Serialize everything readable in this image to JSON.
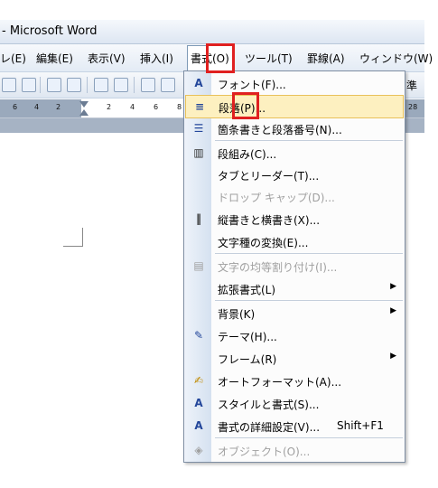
{
  "window": {
    "title": "- Microsoft Word"
  },
  "menubar": {
    "items": [
      "レ(E)",
      "編集(E)",
      "表示(V)",
      "挿入(I)",
      "書式(O)",
      "ツール(T)",
      "罫線(A)",
      "ウィンドウ(W)"
    ]
  },
  "toolbar": {
    "trailing_text": "準"
  },
  "ruler": {
    "ticks": [
      "6",
      "4",
      "2",
      "2",
      "4",
      "6",
      "8",
      "28"
    ]
  },
  "format_menu": {
    "items": [
      {
        "label": "フォント(F)...",
        "icon": "font-icon"
      },
      {
        "label": "段落(P)...",
        "icon": "paragraph-icon",
        "highlighted": true
      },
      {
        "label": "箇条書きと段落番号(N)...",
        "icon": "bullets-icon"
      },
      {
        "label": "段組み(C)...",
        "icon": "columns-icon"
      },
      {
        "label": "タブとリーダー(T)..."
      },
      {
        "label": "ドロップ キャップ(D)...",
        "disabled": true
      },
      {
        "label": "縦書きと横書き(X)...",
        "icon": "text-direction-icon"
      },
      {
        "label": "文字種の変換(E)..."
      },
      {
        "label": "文字の均等割り付け(I)...",
        "icon": "distribute-icon",
        "disabled": true
      },
      {
        "label": "拡張書式(L)",
        "submenu": true
      },
      {
        "label": "背景(K)",
        "submenu": true
      },
      {
        "label": "テーマ(H)...",
        "icon": "theme-icon"
      },
      {
        "label": "フレーム(R)",
        "submenu": true
      },
      {
        "label": "オートフォーマット(A)...",
        "icon": "autoformat-icon"
      },
      {
        "label": "スタイルと書式(S)...",
        "icon": "styles-icon"
      },
      {
        "label": "書式の詳細設定(V)...",
        "icon": "reveal-formatting-icon",
        "shortcut": "Shift+F1"
      },
      {
        "label": "オブジェクト(O)...",
        "icon": "object-icon",
        "disabled": true
      }
    ]
  },
  "colors": {
    "highlight": "#fdf0c0",
    "annotation": "#e02020"
  }
}
